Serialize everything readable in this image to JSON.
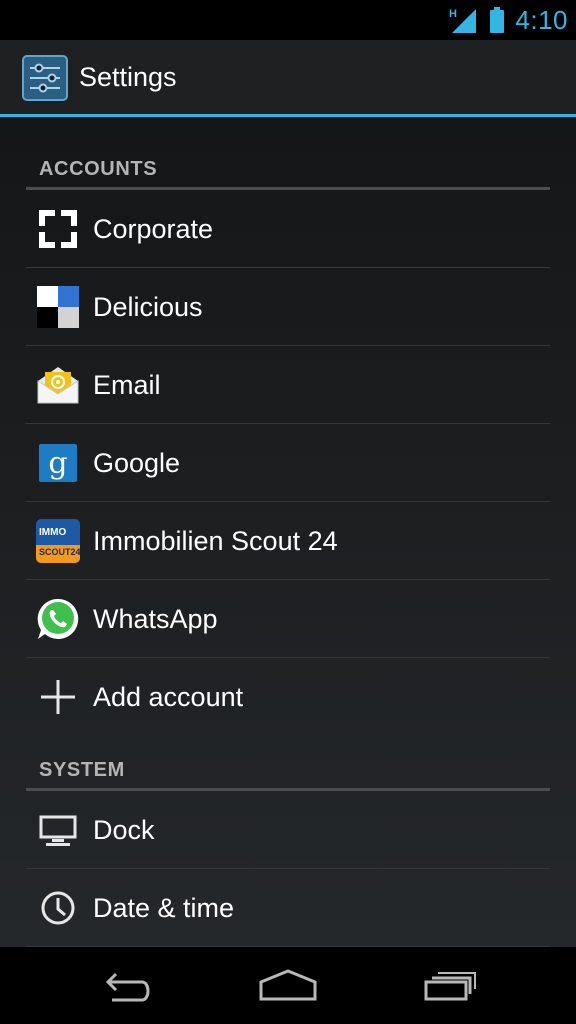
{
  "status_bar": {
    "network_type": "H",
    "time": "4:10"
  },
  "action_bar": {
    "title": "Settings",
    "app_icon": "settings-sliders-icon"
  },
  "colors": {
    "accent": "#33b5e5",
    "text_primary": "#ffffff",
    "section_header": "#b4b4b4"
  },
  "sections": {
    "accounts": {
      "label": "ACCOUNTS",
      "items": [
        {
          "label": "Corporate",
          "icon": "corporate-icon"
        },
        {
          "label": "Delicious",
          "icon": "delicious-icon"
        },
        {
          "label": "Email",
          "icon": "email-icon"
        },
        {
          "label": "Google",
          "icon": "google-icon"
        },
        {
          "label": "Immobilien Scout 24",
          "icon": "immoscout-icon",
          "icon_text_top": "IMMO",
          "icon_text_bottom": "SCOUT24"
        },
        {
          "label": "WhatsApp",
          "icon": "whatsapp-icon"
        },
        {
          "label": "Add account",
          "icon": "plus-icon"
        }
      ]
    },
    "system": {
      "label": "SYSTEM",
      "items": [
        {
          "label": "Dock",
          "icon": "dock-monitor-icon"
        },
        {
          "label": "Date & time",
          "icon": "clock-icon"
        }
      ]
    }
  },
  "nav_bar": {
    "back": "back-icon",
    "home": "home-icon",
    "recents": "recents-icon"
  }
}
